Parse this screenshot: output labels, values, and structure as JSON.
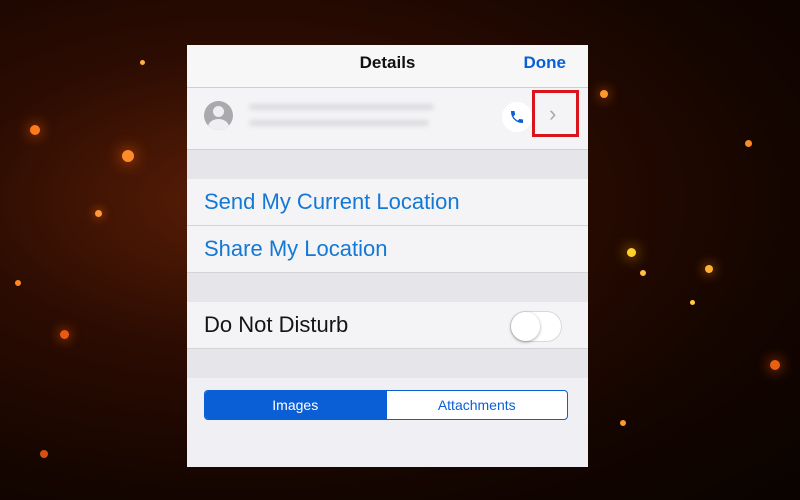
{
  "navbar": {
    "title": "Details",
    "done_label": "Done"
  },
  "contact": {
    "name": "",
    "subtitle": ""
  },
  "location": {
    "send_label": "Send My Current Location",
    "share_label": "Share My Location"
  },
  "settings": {
    "dnd_label": "Do Not Disturb",
    "dnd_enabled": false
  },
  "segments": [
    {
      "label": "Images",
      "selected": true
    },
    {
      "label": "Attachments",
      "selected": false
    }
  ],
  "colors": {
    "accent": "#0a5fd6",
    "link": "#1378d6",
    "highlight_box": "#d8141c"
  }
}
